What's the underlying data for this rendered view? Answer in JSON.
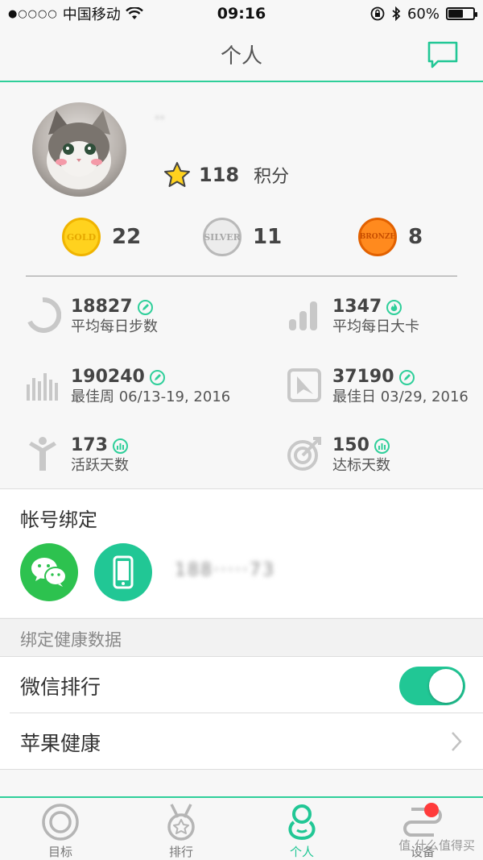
{
  "status_bar": {
    "signal": "●○○○○",
    "carrier": "中国移动",
    "time": "09:16",
    "battery": "60%",
    "battery_level": 0.6
  },
  "nav": {
    "title": "个人",
    "message_icon": "chat-bubble-icon"
  },
  "profile": {
    "username": "··",
    "points_value": "118",
    "points_label": "积分"
  },
  "medals": [
    {
      "name": "GOLD",
      "count": "22",
      "color": "#f7c900"
    },
    {
      "name": "SILVER",
      "count": "11",
      "color": "#c8c8c8"
    },
    {
      "name": "BRONZE",
      "count": "8",
      "color": "#ff7a00"
    }
  ],
  "stats": {
    "avg_steps": {
      "value": "18827",
      "label": "平均每日步数"
    },
    "avg_kcal": {
      "value": "1347",
      "label": "平均每日大卡"
    },
    "best_week": {
      "value": "190240",
      "label": "最佳周 06/13-19, 2016"
    },
    "best_day": {
      "value": "37190",
      "label": "最佳日 03/29, 2016"
    },
    "active_days": {
      "value": "173",
      "label": "活跃天数"
    },
    "goal_days": {
      "value": "150",
      "label": "达标天数"
    }
  },
  "account": {
    "title": "帐号绑定",
    "phone": "188·····73"
  },
  "health": {
    "section_title": "绑定健康数据",
    "wechat_rank": "微信排行",
    "wechat_rank_on": true,
    "apple_health": "苹果健康"
  },
  "tabs": [
    {
      "label": "目标",
      "icon": "target-icon"
    },
    {
      "label": "排行",
      "icon": "medal-icon"
    },
    {
      "label": "个人",
      "icon": "person-icon",
      "active": true
    },
    {
      "label": "设备",
      "icon": "band-device-icon"
    }
  ],
  "colors": {
    "accent": "#21c795",
    "accent_line": "#2fcf9a",
    "wechat_green": "#2dc24f",
    "badge_red": "#ff3b3b"
  },
  "watermark": "值 什么值得买"
}
